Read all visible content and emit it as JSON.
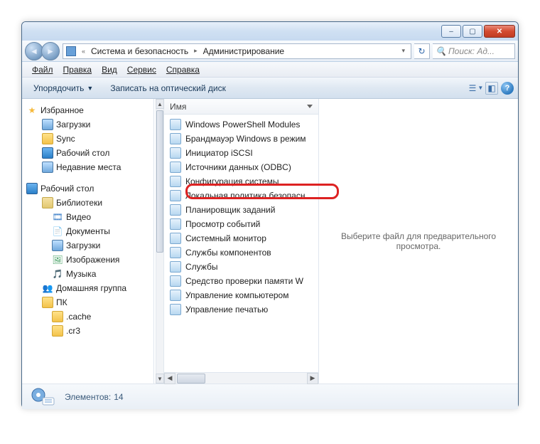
{
  "window": {
    "minimize": "–",
    "maximize": "▢",
    "close": "✕"
  },
  "address": {
    "seg1": "Система и безопасность",
    "seg2": "Администрирование"
  },
  "search": {
    "placeholder": "Поиск: Ад..."
  },
  "menubar": {
    "file": "Файл",
    "edit": "Правка",
    "view": "Вид",
    "tools": "Сервис",
    "help": "Справка"
  },
  "toolbar": {
    "organize": "Упорядочить",
    "burn": "Записать на оптический диск"
  },
  "sidebar": {
    "favorites": "Избранное",
    "downloads": "Загрузки",
    "sync": "Sync",
    "desktop_fav": "Рабочий стол",
    "recent": "Недавние места",
    "desktop": "Рабочий стол",
    "libraries": "Библиотеки",
    "videos": "Видео",
    "documents": "Документы",
    "downloads2": "Загрузки",
    "pictures": "Изображения",
    "music": "Музыка",
    "homegroup": "Домашняя группа",
    "pc": "ПК",
    "cache": ".cache",
    "cr3": ".cr3"
  },
  "column_header": "Имя",
  "files": {
    "i0": "Windows PowerShell Modules",
    "i1": "Брандмауэр Windows в режим",
    "i2": "Инициатор iSCSI",
    "i3": "Источники данных (ODBC)",
    "i4": "Конфигурация системы",
    "i5": "Локальная политика безопасн",
    "i6": "Планировщик заданий",
    "i7": "Просмотр событий",
    "i8": "Системный монитор",
    "i9": "Службы компонентов",
    "i10": "Службы",
    "i11": "Средство проверки памяти W",
    "i12": "Управление компьютером",
    "i13": "Управление печатью"
  },
  "preview_text": "Выберите файл для предварительного просмотра.",
  "status": {
    "count_label": "Элементов:",
    "count_value": "14"
  }
}
